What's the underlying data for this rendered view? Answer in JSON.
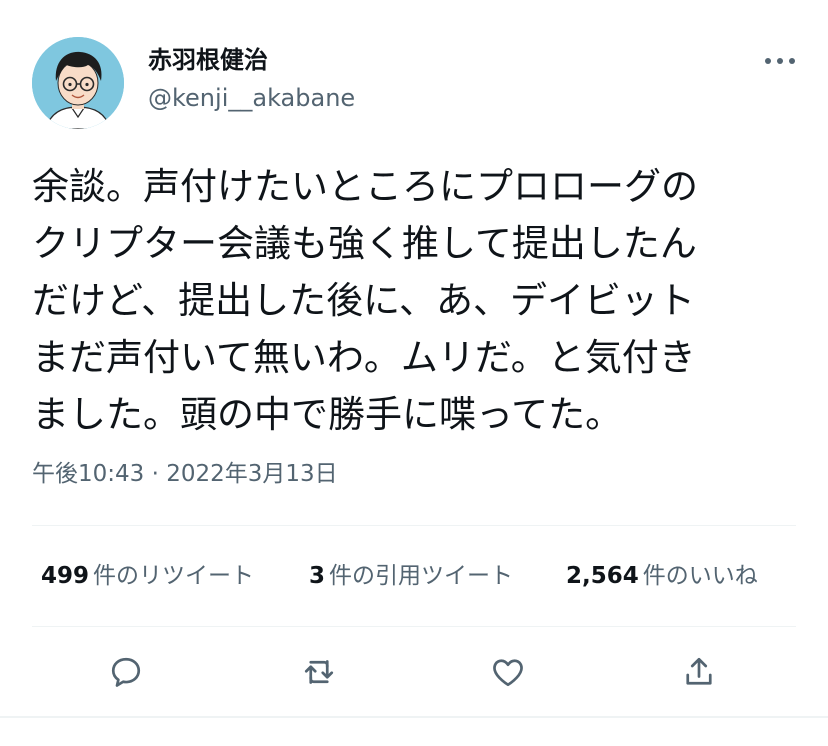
{
  "author": {
    "display_name": "赤羽根健治",
    "handle": "@kenji__akabane",
    "avatar_icon": "avatar-illustration"
  },
  "tweet": {
    "text_lines": [
      "余談。声付けたいところにプロローグの",
      "クリプター会議も強く推して提出したん",
      "だけど、提出した後に、あ、デイビット",
      "まだ声付いて無いわ。ムリだ。と気付き",
      "ました。頭の中で勝手に喋ってた。"
    ],
    "timestamp": "午後10:43 · 2022年3月13日"
  },
  "stats": {
    "retweets": {
      "count": "499",
      "label": "件のリツイート"
    },
    "quotes": {
      "count": "3",
      "label": "件の引用ツイート"
    },
    "likes": {
      "count": "2,564",
      "label": "件のいいね"
    }
  },
  "actions": {
    "reply_icon": "reply-icon",
    "retweet_icon": "retweet-icon",
    "like_icon": "heart-icon",
    "share_icon": "share-icon"
  },
  "colors": {
    "text_primary": "#0f1419",
    "text_secondary": "#536471",
    "divider": "#eff3f4",
    "avatar_bg": "#7fc7df"
  }
}
